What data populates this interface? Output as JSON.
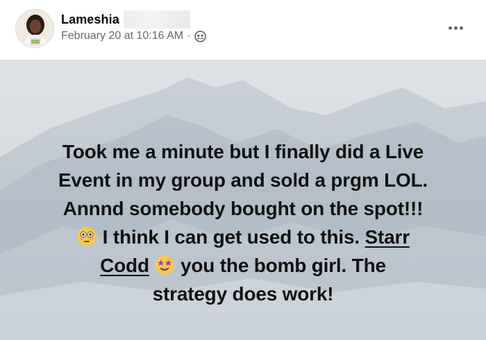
{
  "post": {
    "author": {
      "name": "Lameshia"
    },
    "timestamp": "February 20 at 10:16 AM",
    "separator": "·",
    "audience_icon": "friends-audience-icon",
    "more_icon": "more-options-icon",
    "text": {
      "line1": "Took me a minute but I finally did a Live",
      "line2": "Event in my group and sold a prgm LOL.",
      "line3": "Annnd somebody bought on the spot!!!",
      "line4_after_emoji": " I think I can get used to this. ",
      "mention_part1": "Starr",
      "mention_part2": "Codd",
      "line5_after_emoji": " you the bomb girl. The",
      "line6": "strategy does work!"
    },
    "emojis": [
      "flushed-face-emoji",
      "star-struck-emoji"
    ]
  },
  "colors": {
    "text_primary": "#050505",
    "text_secondary": "#65676b",
    "background_tint": "#d9dde2"
  }
}
